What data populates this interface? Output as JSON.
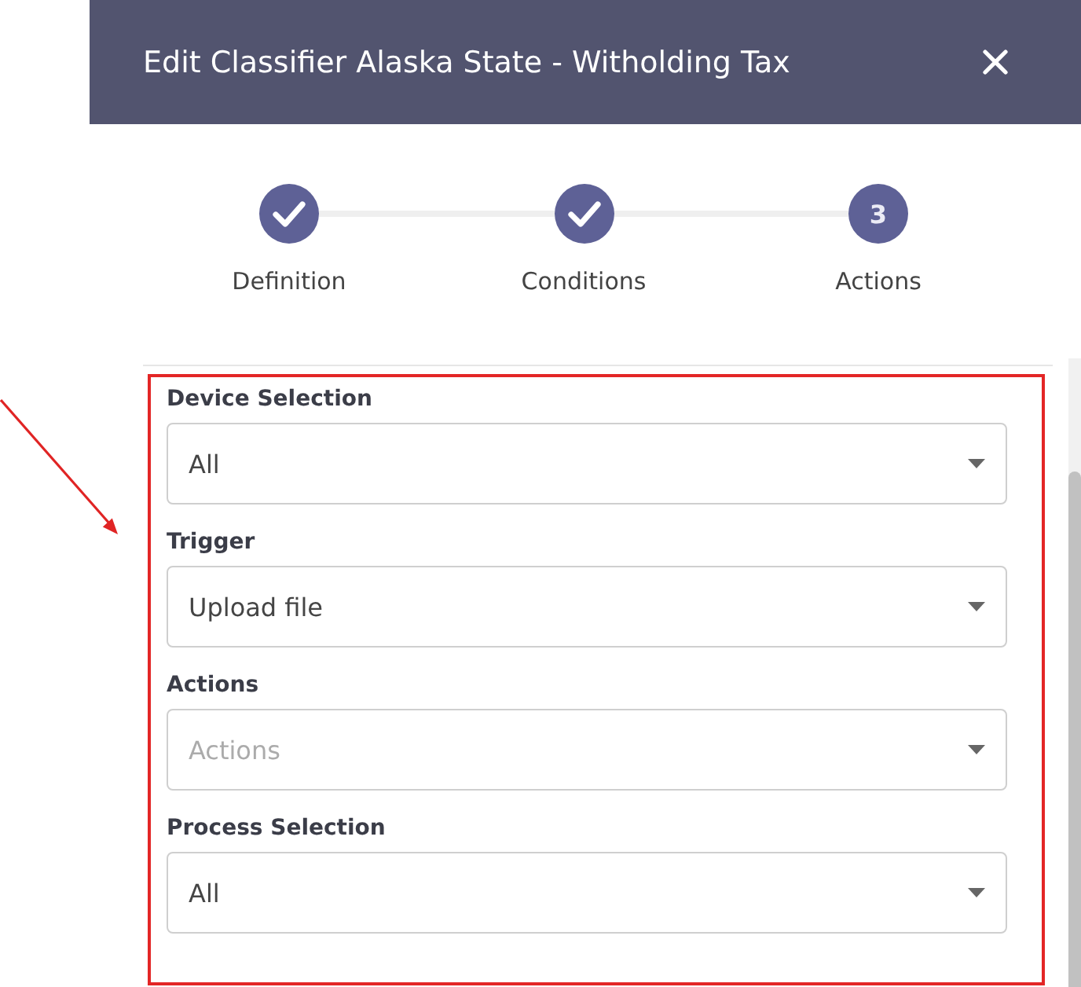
{
  "dialog": {
    "title": "Edit Classifier Alaska State - Witholding Tax"
  },
  "steps": [
    {
      "label": "Definition",
      "completed": true
    },
    {
      "label": "Conditions",
      "completed": true
    },
    {
      "label": "Actions",
      "completed": false,
      "number": "3"
    }
  ],
  "fields": [
    {
      "label": "Device Selection",
      "value": "All"
    },
    {
      "label": "Trigger",
      "value": "Upload file"
    },
    {
      "label": "Actions",
      "placeholder": "Actions"
    },
    {
      "label": "Process Selection",
      "value": "All"
    }
  ],
  "annotation": {
    "highlight_frame": true,
    "arrow": true
  }
}
